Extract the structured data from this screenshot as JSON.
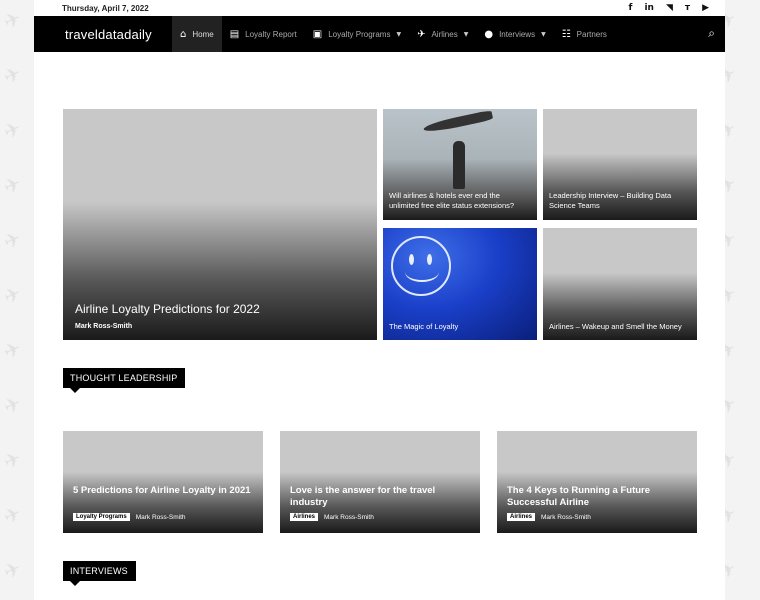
{
  "topbar": {
    "date": "Thursday, April 7, 2022",
    "socials": [
      {
        "icon": "facebook-icon",
        "glyph": "f"
      },
      {
        "icon": "linkedin-icon",
        "glyph": "in"
      },
      {
        "icon": "rss-icon",
        "glyph": "◥"
      },
      {
        "icon": "twitter-icon",
        "glyph": "ᴛ"
      },
      {
        "icon": "youtube-icon",
        "glyph": "▶"
      }
    ]
  },
  "nav": {
    "logo": "traveldatadaily",
    "items": [
      {
        "label": "Home",
        "icon": "home-icon",
        "glyph": "⌂",
        "dropdown": false,
        "active": true
      },
      {
        "label": "Loyalty Report",
        "icon": "newspaper-icon",
        "glyph": "▤",
        "dropdown": false,
        "active": false
      },
      {
        "label": "Loyalty Programs",
        "icon": "card-icon",
        "glyph": "▣",
        "dropdown": true,
        "active": false
      },
      {
        "label": "Airlines",
        "icon": "plane-icon",
        "glyph": "✈",
        "dropdown": true,
        "active": false
      },
      {
        "label": "Interviews",
        "icon": "user-icon",
        "glyph": "●",
        "dropdown": true,
        "active": false
      },
      {
        "label": "Partners",
        "icon": "handshake-icon",
        "glyph": "☷",
        "dropdown": false,
        "active": false
      }
    ],
    "search_icon": "search-icon"
  },
  "featured": {
    "big": {
      "title": "Airline Loyalty Predictions for 2022",
      "author": "Mark Ross-Smith"
    },
    "small": [
      {
        "title": "Will airlines & hotels ever end the unlimited free elite status extensions?"
      },
      {
        "title": "Leadership Interview – Building Data Science Teams"
      },
      {
        "title": "The Magic of Loyalty"
      },
      {
        "title": "Airlines – Wakeup and Smell the Money"
      }
    ]
  },
  "sections": {
    "thought_leadership": {
      "title": "THOUGHT LEADERSHIP"
    },
    "interviews": {
      "title": "INTERVIEWS"
    }
  },
  "thought_leadership_posts": [
    {
      "title": "5 Predictions for Airline Loyalty in 2021",
      "category": "Loyalty Programs",
      "author": "Mark Ross-Smith"
    },
    {
      "title": "Love is the answer for the travel industry",
      "category": "Airlines",
      "author": "Mark Ross-Smith"
    },
    {
      "title": "The 4 Keys to Running a Future Successful Airline",
      "category": "Airlines",
      "author": "Mark Ross-Smith"
    }
  ]
}
